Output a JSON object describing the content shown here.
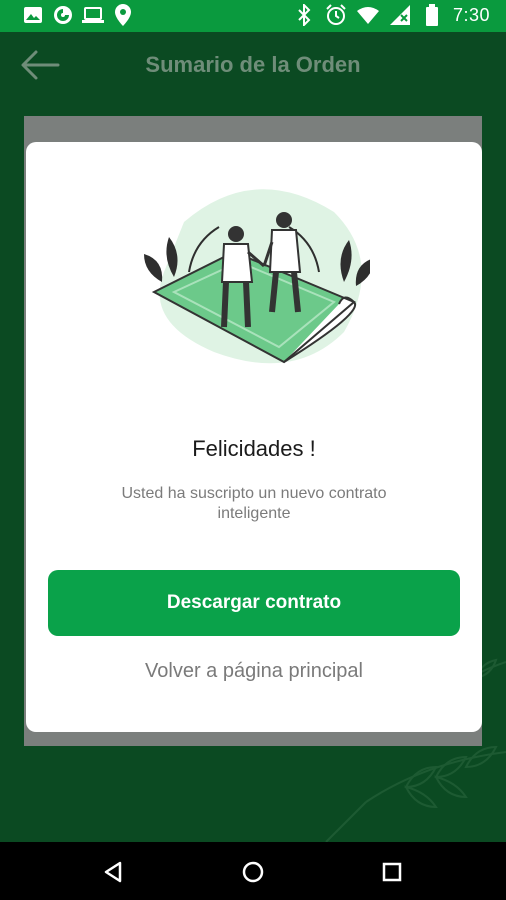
{
  "status_bar": {
    "time": "7:30",
    "left_icons": [
      "image-icon",
      "firefox-icon",
      "laptop-icon",
      "location-icon"
    ],
    "right_icons": [
      "bluetooth-icon",
      "alarm-icon",
      "wifi-icon",
      "signal-icon",
      "battery-icon"
    ]
  },
  "app_bar": {
    "title": "Sumario de la Orden",
    "back_icon": "arrow-left-icon"
  },
  "dialog": {
    "title": "Felicidades !",
    "message": "Usted ha suscripto un nuevo contrato inteligente",
    "primary_button": "Descargar contrato",
    "secondary_link": "Volver a página principal"
  },
  "colors": {
    "status_bar": "#0a9a3e",
    "background": "#0b4a22",
    "primary": "#0aa24a",
    "dialog": "#ffffff"
  },
  "nav_bar": {
    "icons": [
      "back-triangle-icon",
      "home-circle-icon",
      "recents-square-icon"
    ]
  }
}
